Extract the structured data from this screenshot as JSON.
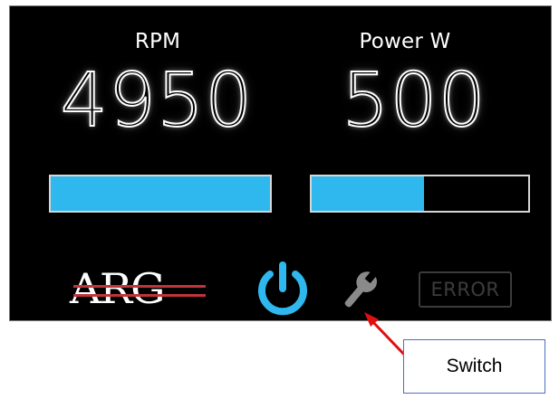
{
  "display": {
    "rpm": {
      "label": "RPM",
      "value": "4950",
      "bar_level_fraction": 1.0
    },
    "power": {
      "label": "Power W",
      "value": "500",
      "bar_level_fraction": 0.52
    },
    "logo_text": "ARG",
    "power_button": {
      "icon": "power-icon",
      "state": "on"
    },
    "settings_button": {
      "icon": "wrench-icon"
    },
    "error_indicator": {
      "label": "ERROR",
      "state": "inactive"
    }
  },
  "annotation": {
    "callout_text": "Switch"
  },
  "colors": {
    "panel_background": "#000000",
    "bar_fill": "#2fb8ee",
    "power_icon": "#2fb8ee",
    "wrench_icon": "#8a8a8a",
    "error_inactive": "#3c3c3c",
    "logo_accent": "#c0343a",
    "arrow": "#e01010",
    "callout_border": "#4a6fc5"
  }
}
